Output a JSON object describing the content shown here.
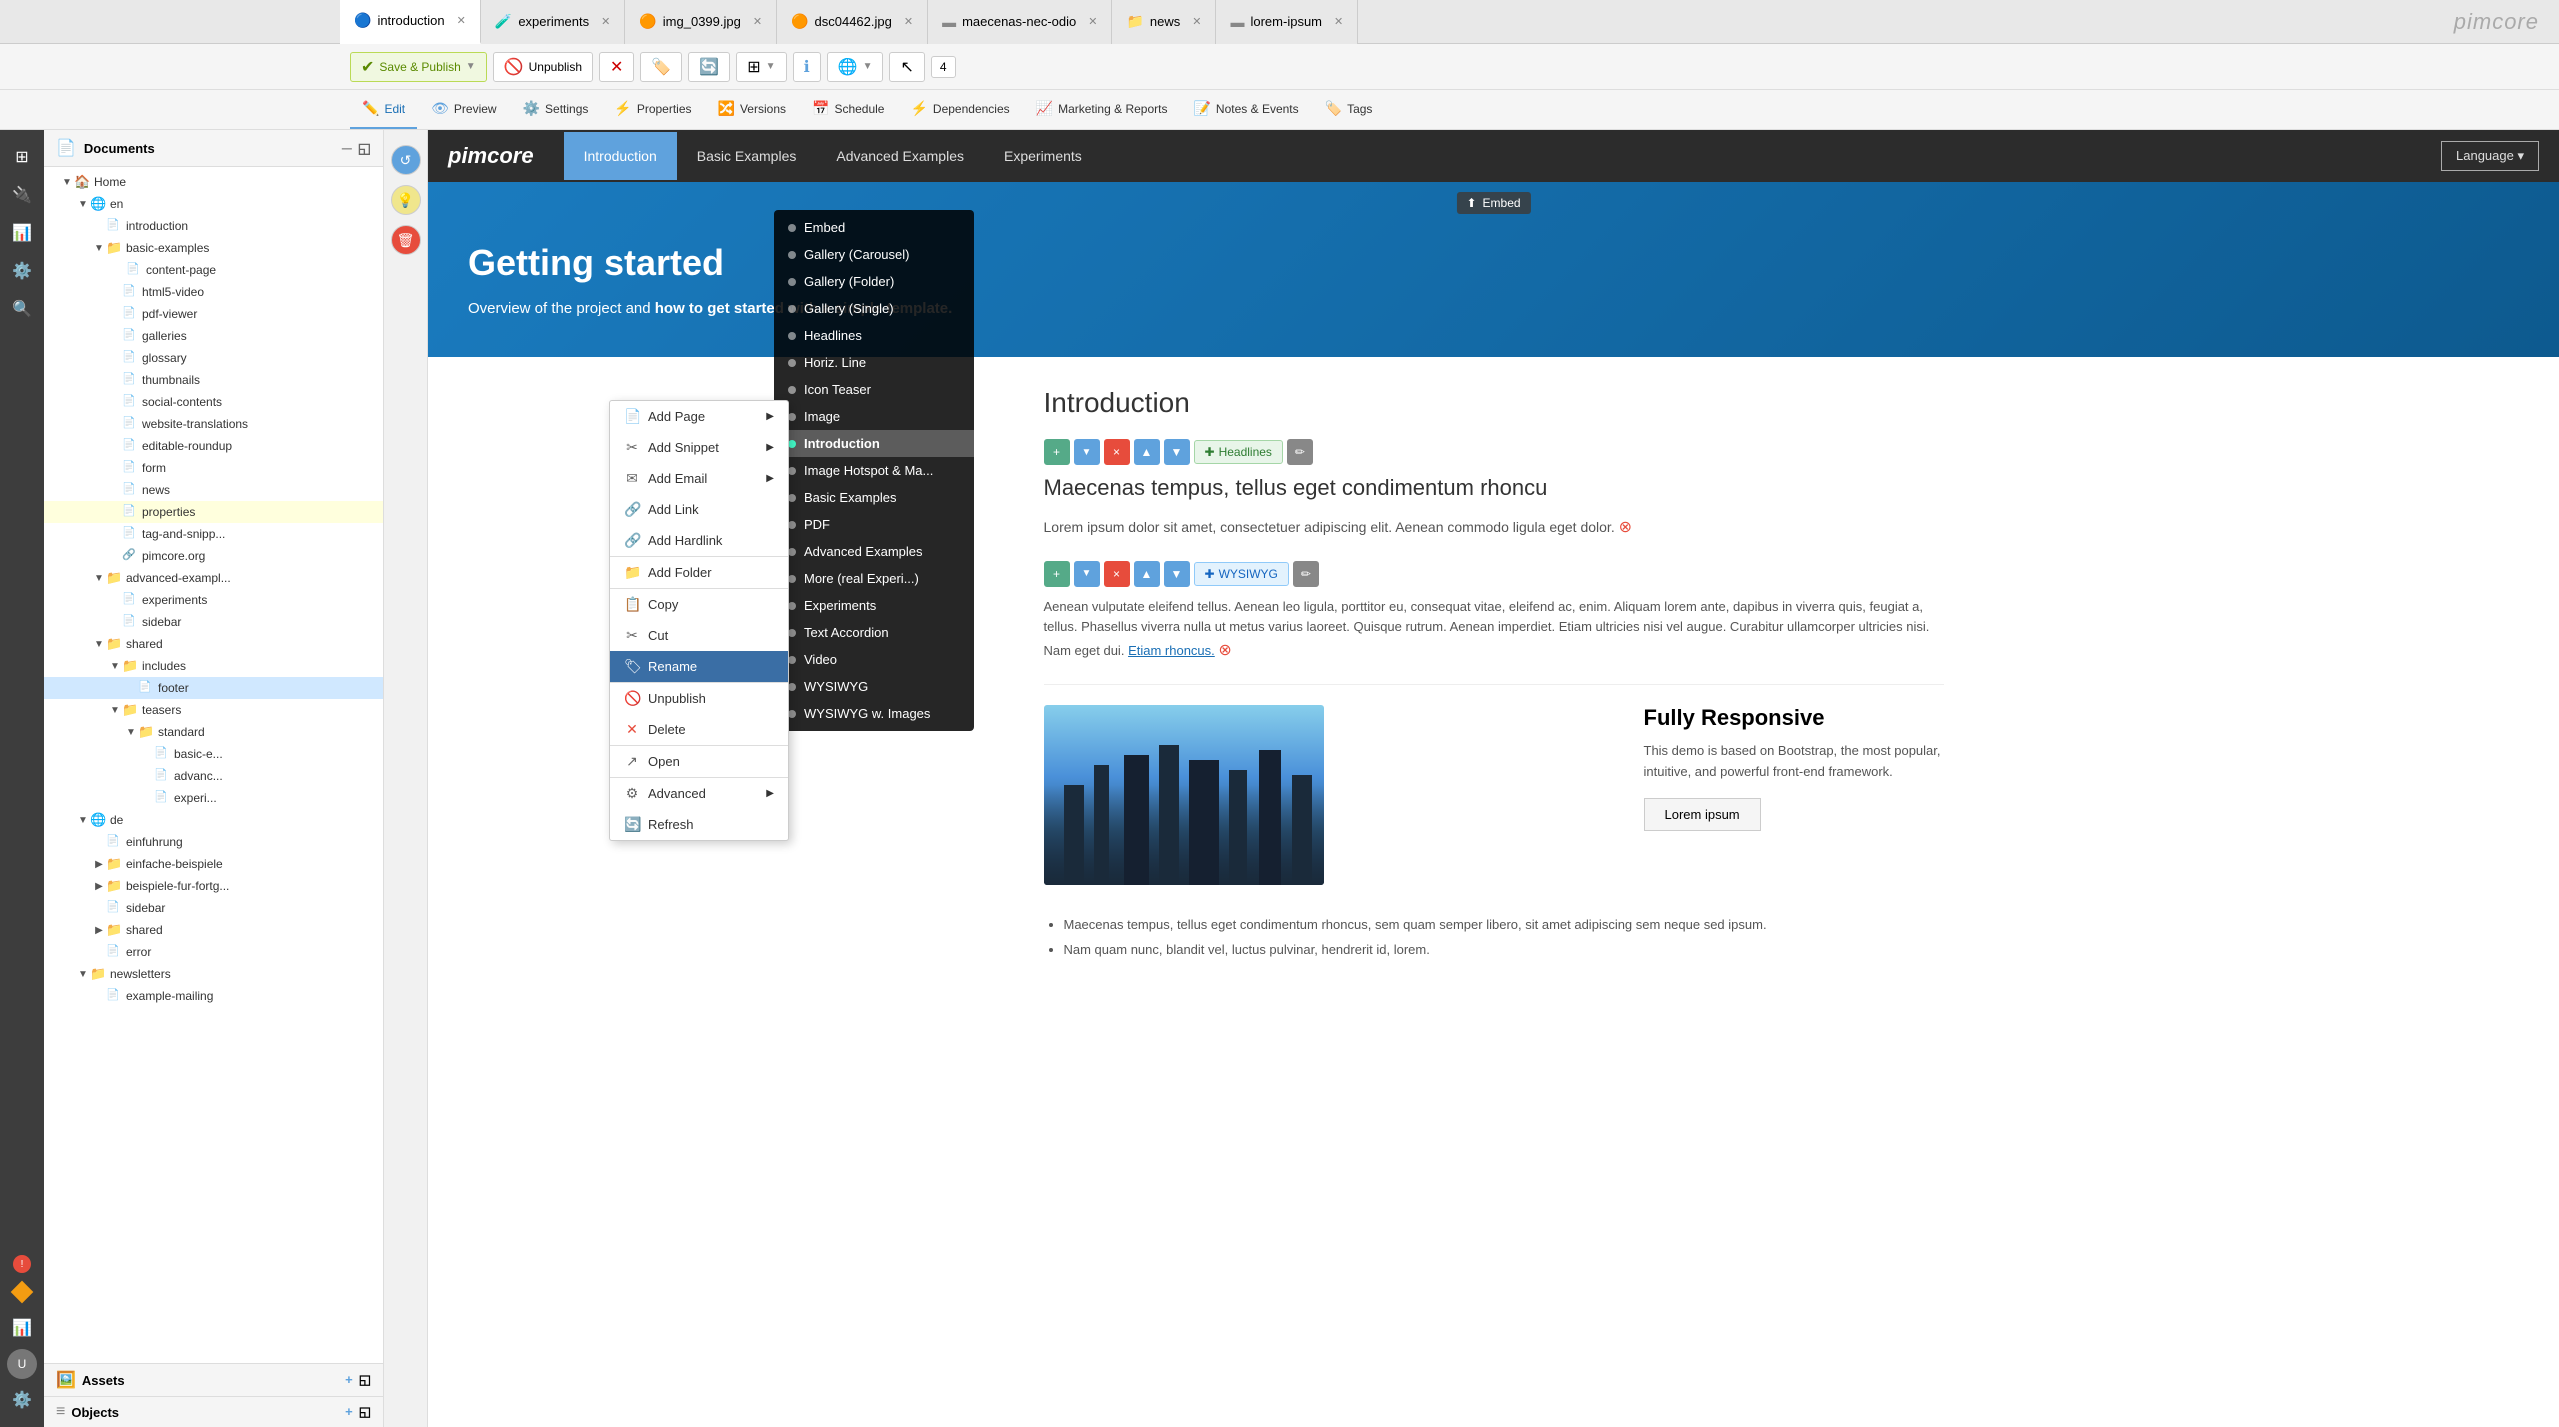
{
  "app": {
    "title": "pimcore",
    "logo": "pimcore"
  },
  "tabs": [
    {
      "id": "introduction",
      "label": "introduction",
      "icon": "🔵",
      "active": true,
      "color": "#5fa2dd"
    },
    {
      "id": "experiments",
      "label": "experiments",
      "icon": "🧪",
      "active": false,
      "color": "#5fa2dd"
    },
    {
      "id": "img_0399",
      "label": "img_0399.jpg",
      "icon": "🟠",
      "active": false,
      "color": "#e67e22"
    },
    {
      "id": "dsc04462",
      "label": "dsc04462.jpg",
      "icon": "🟠",
      "active": false,
      "color": "#e67e22"
    },
    {
      "id": "maecenas-nec-odio",
      "label": "maecenas-nec-odio",
      "icon": "▬",
      "active": false,
      "color": "#888"
    },
    {
      "id": "news",
      "label": "news",
      "icon": "📁",
      "active": false,
      "color": "#f0b429"
    },
    {
      "id": "lorem-ipsum",
      "label": "lorem-ipsum",
      "icon": "▬",
      "active": false,
      "color": "#888"
    }
  ],
  "toolbar": {
    "save_publish_label": "Save & Publish",
    "unpublish_label": "Unpublish",
    "num_value": "4"
  },
  "action_bar": {
    "edit_label": "Edit",
    "preview_label": "Preview",
    "settings_label": "Settings",
    "properties_label": "Properties",
    "versions_label": "Versions",
    "schedule_label": "Schedule",
    "dependencies_label": "Dependencies",
    "marketing_label": "Marketing & Reports",
    "notes_label": "Notes & Events",
    "tags_label": "Tags"
  },
  "sidebar": {
    "title": "Documents",
    "tree": [
      {
        "id": "home",
        "label": "Home",
        "indent": 1,
        "type": "home",
        "expanded": true
      },
      {
        "id": "en",
        "label": "en",
        "indent": 2,
        "type": "globe",
        "expanded": true
      },
      {
        "id": "introduction",
        "label": "introduction",
        "indent": 3,
        "type": "page"
      },
      {
        "id": "basic-examples",
        "label": "basic-examples",
        "indent": 3,
        "type": "folder",
        "expanded": true
      },
      {
        "id": "content-page",
        "label": "content-page",
        "indent": 4,
        "type": "page"
      },
      {
        "id": "html5-video",
        "label": "html5-video",
        "indent": 4,
        "type": "page"
      },
      {
        "id": "pdf-viewer",
        "label": "pdf-viewer",
        "indent": 4,
        "type": "page"
      },
      {
        "id": "galleries",
        "label": "galleries",
        "indent": 4,
        "type": "page"
      },
      {
        "id": "glossary",
        "label": "glossary",
        "indent": 4,
        "type": "page"
      },
      {
        "id": "thumbnails",
        "label": "thumbnails",
        "indent": 4,
        "type": "page"
      },
      {
        "id": "social-contents",
        "label": "social-contents",
        "indent": 4,
        "type": "page"
      },
      {
        "id": "website-translations",
        "label": "website-translations",
        "indent": 4,
        "type": "page"
      },
      {
        "id": "editable-roundup",
        "label": "editable-roundup",
        "indent": 4,
        "type": "page"
      },
      {
        "id": "form",
        "label": "form",
        "indent": 4,
        "type": "page"
      },
      {
        "id": "news",
        "label": "news",
        "indent": 4,
        "type": "page"
      },
      {
        "id": "properties",
        "label": "properties",
        "indent": 4,
        "type": "page",
        "selected": true
      },
      {
        "id": "tag-and-snipp",
        "label": "tag-and-snipp...",
        "indent": 4,
        "type": "page"
      },
      {
        "id": "pimcore-org",
        "label": "pimcore.org",
        "indent": 4,
        "type": "link"
      },
      {
        "id": "advanced-exampl",
        "label": "advanced-exampl...",
        "indent": 3,
        "type": "folder",
        "expanded": true
      },
      {
        "id": "experiments",
        "label": "experiments",
        "indent": 4,
        "type": "page"
      },
      {
        "id": "sidebar",
        "label": "sidebar",
        "indent": 4,
        "type": "page"
      },
      {
        "id": "shared",
        "label": "shared",
        "indent": 3,
        "type": "folder-yellow",
        "expanded": true
      },
      {
        "id": "includes",
        "label": "includes",
        "indent": 4,
        "type": "folder",
        "expanded": true
      },
      {
        "id": "footer",
        "label": "footer",
        "indent": 5,
        "type": "page",
        "highlighted": true
      },
      {
        "id": "teasers",
        "label": "teasers",
        "indent": 4,
        "type": "folder",
        "expanded": true
      },
      {
        "id": "standard",
        "label": "standard",
        "indent": 5,
        "type": "folder",
        "expanded": true
      },
      {
        "id": "basic-e",
        "label": "basic-e...",
        "indent": 6,
        "type": "page"
      },
      {
        "id": "advanc",
        "label": "advanc...",
        "indent": 6,
        "type": "page"
      },
      {
        "id": "experi",
        "label": "experi...",
        "indent": 6,
        "type": "page"
      },
      {
        "id": "de",
        "label": "de",
        "indent": 2,
        "type": "globe",
        "expanded": true
      },
      {
        "id": "einfuhrung",
        "label": "einfuhrung",
        "indent": 3,
        "type": "page"
      },
      {
        "id": "einfache-beispiele",
        "label": "einfache-beispiele",
        "indent": 3,
        "type": "folder"
      },
      {
        "id": "beispiele-fur-fortg",
        "label": "beispiele-fur-fortg...",
        "indent": 3,
        "type": "folder"
      },
      {
        "id": "sidebar-de",
        "label": "sidebar",
        "indent": 3,
        "type": "page"
      },
      {
        "id": "shared-de",
        "label": "shared",
        "indent": 3,
        "type": "folder-yellow"
      },
      {
        "id": "error",
        "label": "error",
        "indent": 3,
        "type": "page"
      },
      {
        "id": "newsletters",
        "label": "newsletters",
        "indent": 2,
        "type": "folder",
        "expanded": true
      },
      {
        "id": "example-mailing",
        "label": "example-mailing",
        "indent": 3,
        "type": "page"
      }
    ]
  },
  "context_menu": {
    "items": [
      {
        "id": "add-page",
        "label": "Add Page",
        "icon": "📄",
        "has_arrow": true
      },
      {
        "id": "add-snippet",
        "label": "Add Snippet",
        "icon": "✂️",
        "has_arrow": true
      },
      {
        "id": "add-email",
        "label": "Add Email",
        "icon": "✉️",
        "has_arrow": true
      },
      {
        "id": "add-link",
        "label": "Add Link",
        "icon": "🔗",
        "has_arrow": false
      },
      {
        "id": "add-hardlink",
        "label": "Add Hardlink",
        "icon": "🔗",
        "has_arrow": false
      },
      {
        "id": "add-folder",
        "label": "Add Folder",
        "icon": "📁",
        "has_arrow": false
      },
      {
        "id": "copy",
        "label": "Copy",
        "icon": "📋",
        "has_arrow": false
      },
      {
        "id": "cut",
        "label": "Cut",
        "icon": "✂️",
        "has_arrow": false
      },
      {
        "id": "rename",
        "label": "Rename",
        "icon": "🏷️",
        "has_arrow": false,
        "active": true
      },
      {
        "id": "unpublish",
        "label": "Unpublish",
        "icon": "🚫",
        "has_arrow": false
      },
      {
        "id": "delete",
        "label": "Delete",
        "icon": "❌",
        "has_arrow": false
      },
      {
        "id": "open",
        "label": "Open",
        "icon": "↗️",
        "has_arrow": false
      },
      {
        "id": "advanced",
        "label": "Advanced",
        "icon": "⚙️",
        "has_arrow": true
      },
      {
        "id": "refresh",
        "label": "Refresh",
        "icon": "🔄",
        "has_arrow": false
      }
    ]
  },
  "tool_panel": {
    "items": [
      {
        "label": "Embed",
        "active": false
      },
      {
        "label": "Gallery (Carousel)",
        "active": false
      },
      {
        "label": "Gallery (Folder)",
        "active": false
      },
      {
        "label": "Gallery (Single)",
        "active": false
      },
      {
        "label": "Headlines",
        "active": false
      },
      {
        "label": "Horiz. Line",
        "active": false
      },
      {
        "label": "Icon Teaser",
        "active": false
      },
      {
        "label": "Image",
        "active": false
      },
      {
        "label": "Introduction",
        "active": true
      },
      {
        "label": "Image Hotspot & Ma...",
        "active": false
      },
      {
        "label": "Basic Examples",
        "active": false
      },
      {
        "label": "PDF",
        "active": false
      },
      {
        "label": "Advanced Examples",
        "active": false
      },
      {
        "label": "More (real Experi...)",
        "active": false
      },
      {
        "label": "Experiments",
        "active": false
      },
      {
        "label": "Text Accordion",
        "active": false
      },
      {
        "label": "Video",
        "active": false
      },
      {
        "label": "WYSIWYG",
        "active": false
      },
      {
        "label": "WYSIWYG w. Images",
        "active": false
      }
    ]
  },
  "website": {
    "logo": "pimcore",
    "nav_items": [
      "Introduction",
      "Basic Examples",
      "Advanced Examples",
      "Experiments"
    ],
    "active_nav": "Introduction",
    "lang_btn": "Language ▾",
    "hero_title": "Getting started",
    "hero_text_prefix": "Overview of the project and ",
    "hero_text_bold": "how to get started with a simple template.",
    "section1_title": "Introduction",
    "section1_headlines_label": "Headlines",
    "section1_body": "Maecenas tempus, tellus eget condimentum rhoncu",
    "section1_detail": "Lorem ipsum dolor sit amet, consectetuer adipiscing elit. Aenean commodo ligula eget dolor.",
    "wysiwyg_label": "WYSIWYG",
    "wysiwyg_body": "Aenean vulputate eleifend tellus. Aenean leo ligula, porttitor eu, consequat vitae, eleifend ac, enim. Aliquam lorem ante, dapibus in viverra quis, feugiat a, tellus. Phasellus viverra nulla ut metus varius laoreet. Quisque rutrum. Aenean imperdiet. Etiam ultricies nisi vel augue. Curabitur ullamcorper ultricies nisi. Nam eget dui.",
    "wysiwyg_link": "Etiam rhoncus.",
    "responsive_section_title": "Fully Responsive",
    "responsive_section_text": "This demo is based on Bootstrap, the most popular, intuitive, and powerful front-end framework.",
    "lorem_btn": "Lorem ipsum",
    "bullet1": "Maecenas tempus, tellus eget condimentum rhoncus, sem quam semper libero, sit amet adipiscing sem neque sed ipsum.",
    "bullet2": "Nam quam nunc, blandit vel, luctus pulvinar, hendrerit id, lorem."
  },
  "far_left_icons": [
    {
      "id": "grid",
      "icon": "⊞",
      "active": true
    },
    {
      "id": "plug",
      "icon": "🔌",
      "active": false
    },
    {
      "id": "chart",
      "icon": "📊",
      "active": false
    },
    {
      "id": "gear",
      "icon": "⚙️",
      "active": false
    },
    {
      "id": "search",
      "icon": "🔍",
      "active": false
    }
  ]
}
